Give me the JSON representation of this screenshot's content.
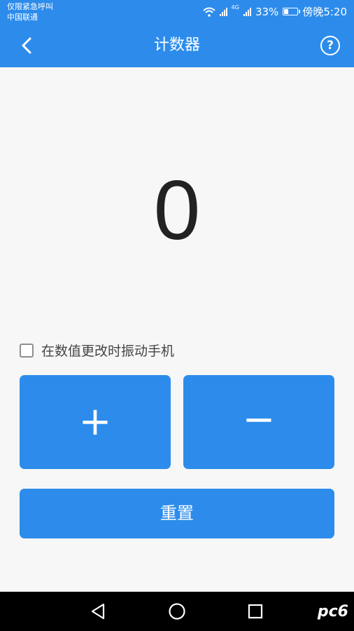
{
  "status": {
    "line1": "仅限紧急呼叫",
    "line2": "中国联通",
    "network": "4G",
    "battery_percent": "33%",
    "battery_level": 0.33,
    "time": "傍晚5:20"
  },
  "header": {
    "title": "计数器",
    "back_icon": "chevron-left-icon",
    "help_icon": "question-circle-icon",
    "help_glyph": "?"
  },
  "counter": {
    "value": "0"
  },
  "options": {
    "vibrate_label": "在数值更改时振动手机",
    "vibrate_checked": false
  },
  "buttons": {
    "increment": "+",
    "decrement": "−",
    "reset": "重置"
  },
  "navbar": {
    "back_icon": "triangle-back-icon",
    "home_icon": "circle-home-icon",
    "recents_icon": "square-recents-icon"
  },
  "watermark": "pc6",
  "colors": {
    "primary": "#2d8ceb",
    "background": "#f7f7f7",
    "counter_text": "#222222"
  }
}
